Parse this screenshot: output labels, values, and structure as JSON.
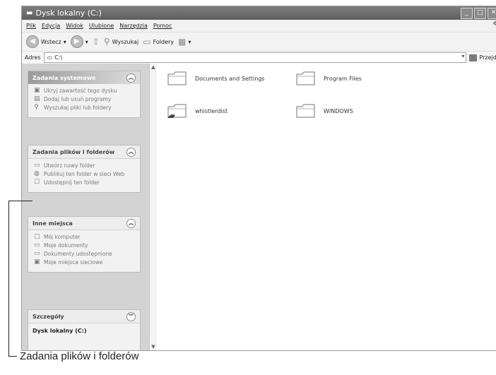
{
  "window": {
    "title": "Dysk lokalny (C:)",
    "title_icon": "folder-icon"
  },
  "menubar": {
    "items": [
      "Plik",
      "Edycja",
      "Widok",
      "Ulubione",
      "Narzędzia",
      "Pomoc"
    ]
  },
  "toolbar": {
    "back_label": "Wstecz",
    "search_label": "Wyszukaj",
    "folders_label": "Foldery"
  },
  "address": {
    "label": "Adres",
    "value": "C:\\",
    "go_label": "Przejdź"
  },
  "panels": {
    "system": {
      "title": "Zadania systemowe",
      "items": [
        {
          "label": "Ukryj zawartość tego dysku",
          "icon": "hide-icon"
        },
        {
          "label": "Dodaj lub usuń programy",
          "icon": "programs-icon"
        },
        {
          "label": "Wyszukaj pliki lub foldery",
          "icon": "search-icon"
        }
      ]
    },
    "files": {
      "title": "Zadania plików i folderów",
      "items": [
        {
          "label": "Utwórz nowy folder",
          "icon": "new-folder-icon"
        },
        {
          "label": "Publikuj ten folder w sieci Web",
          "icon": "web-publish-icon"
        },
        {
          "label": "Udostępnij ten folder",
          "icon": "share-icon"
        }
      ]
    },
    "places": {
      "title": "Inne miejsca",
      "items": [
        {
          "label": "Mój komputer",
          "icon": "computer-icon"
        },
        {
          "label": "Moje dokumenty",
          "icon": "documents-icon"
        },
        {
          "label": "Dokumenty udostępnione",
          "icon": "shared-documents-icon"
        },
        {
          "label": "Moje miejsca sieciowe",
          "icon": "network-icon"
        }
      ]
    },
    "details": {
      "title": "Szczegóły",
      "item": "Dysk lokalny (C:)"
    }
  },
  "folders": [
    {
      "label": "Documents and Settings"
    },
    {
      "label": "Program Files"
    },
    {
      "label": "whistlerdist"
    },
    {
      "label": "WINDOWS"
    }
  ],
  "caption": "Zadania plików i folderów"
}
